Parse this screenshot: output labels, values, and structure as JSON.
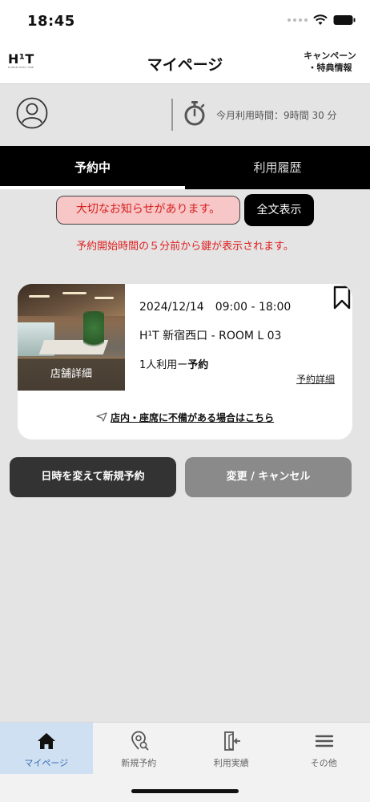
{
  "status_bar": {
    "time": "18:45"
  },
  "header": {
    "logo_text": "H¹T",
    "logo_subtext": "HUMAN FIRST TIME",
    "title": "マイページ",
    "campaign_line1": "キャンペーン",
    "campaign_line2": "・特典情報"
  },
  "profile": {
    "usage_text": "今月利用時間：9時間 30 分"
  },
  "tabs": [
    {
      "label": "予約中",
      "active": true
    },
    {
      "label": "利用履歴",
      "active": false
    }
  ],
  "notice": {
    "badge_text": "大切なお知らせがあります。",
    "fulltext_label": "全文表示",
    "key_note": "予約開始時間の５分前から鍵が表示されます。"
  },
  "reservation": {
    "photo_caption": "店舗詳細",
    "datetime": "2024/12/14　09:00 - 18:00",
    "room": "H¹T 新宿西口 - ROOM L 03",
    "type_prefix": "1人利用ー",
    "type_bold": "予約",
    "details_link": "予約詳細",
    "report_link": "店内・座席に不備がある場合はこちら"
  },
  "actions": {
    "new_booking_label": "日時を変えて新規予約",
    "change_cancel_label": "変更 / キャンセル"
  },
  "bottom_nav": [
    {
      "label": "マイページ",
      "icon": "home-icon",
      "active": true
    },
    {
      "label": "新規予約",
      "icon": "location-search-icon",
      "active": false
    },
    {
      "label": "利用実績",
      "icon": "door-enter-icon",
      "active": false
    },
    {
      "label": "その他",
      "icon": "menu-icon",
      "active": false
    }
  ],
  "colors": {
    "active_nav_bg": "#cfe0f3",
    "active_nav_text": "#3a6fb0",
    "alert_red": "#e02020",
    "notice_bg": "#f7c6c6"
  }
}
